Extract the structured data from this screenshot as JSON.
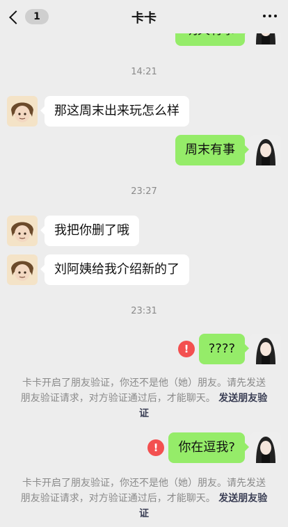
{
  "header": {
    "title": "卡卡",
    "unread_badge": "1",
    "back_icon": "chevron-left-icon",
    "more_icon": "more-dots-icon"
  },
  "timestamps": [
    "14:21",
    "23:27",
    "23:31"
  ],
  "messages": [
    {
      "side": "out",
      "text": "明天有事"
    },
    {
      "side": "in",
      "text": "那这周末出来玩怎么样"
    },
    {
      "side": "out",
      "text": "周末有事"
    },
    {
      "side": "in",
      "text": "我把你删了哦"
    },
    {
      "side": "in",
      "text": "刘阿姨给我介绍新的了"
    },
    {
      "side": "out",
      "text": "????",
      "failed": true
    },
    {
      "side": "out",
      "text": "你在逗我?",
      "failed": true
    }
  ],
  "notice": {
    "text": "卡卡开启了朋友验证，你还不是他（她）朋友。请先发送朋友验证请求，对方验证通过后，才能聊天。",
    "link": "发送朋友验证"
  },
  "colors": {
    "bg": "#ededed",
    "outgoing_bubble": "#95ec69",
    "incoming_bubble": "#ffffff",
    "error": "#f35050"
  }
}
